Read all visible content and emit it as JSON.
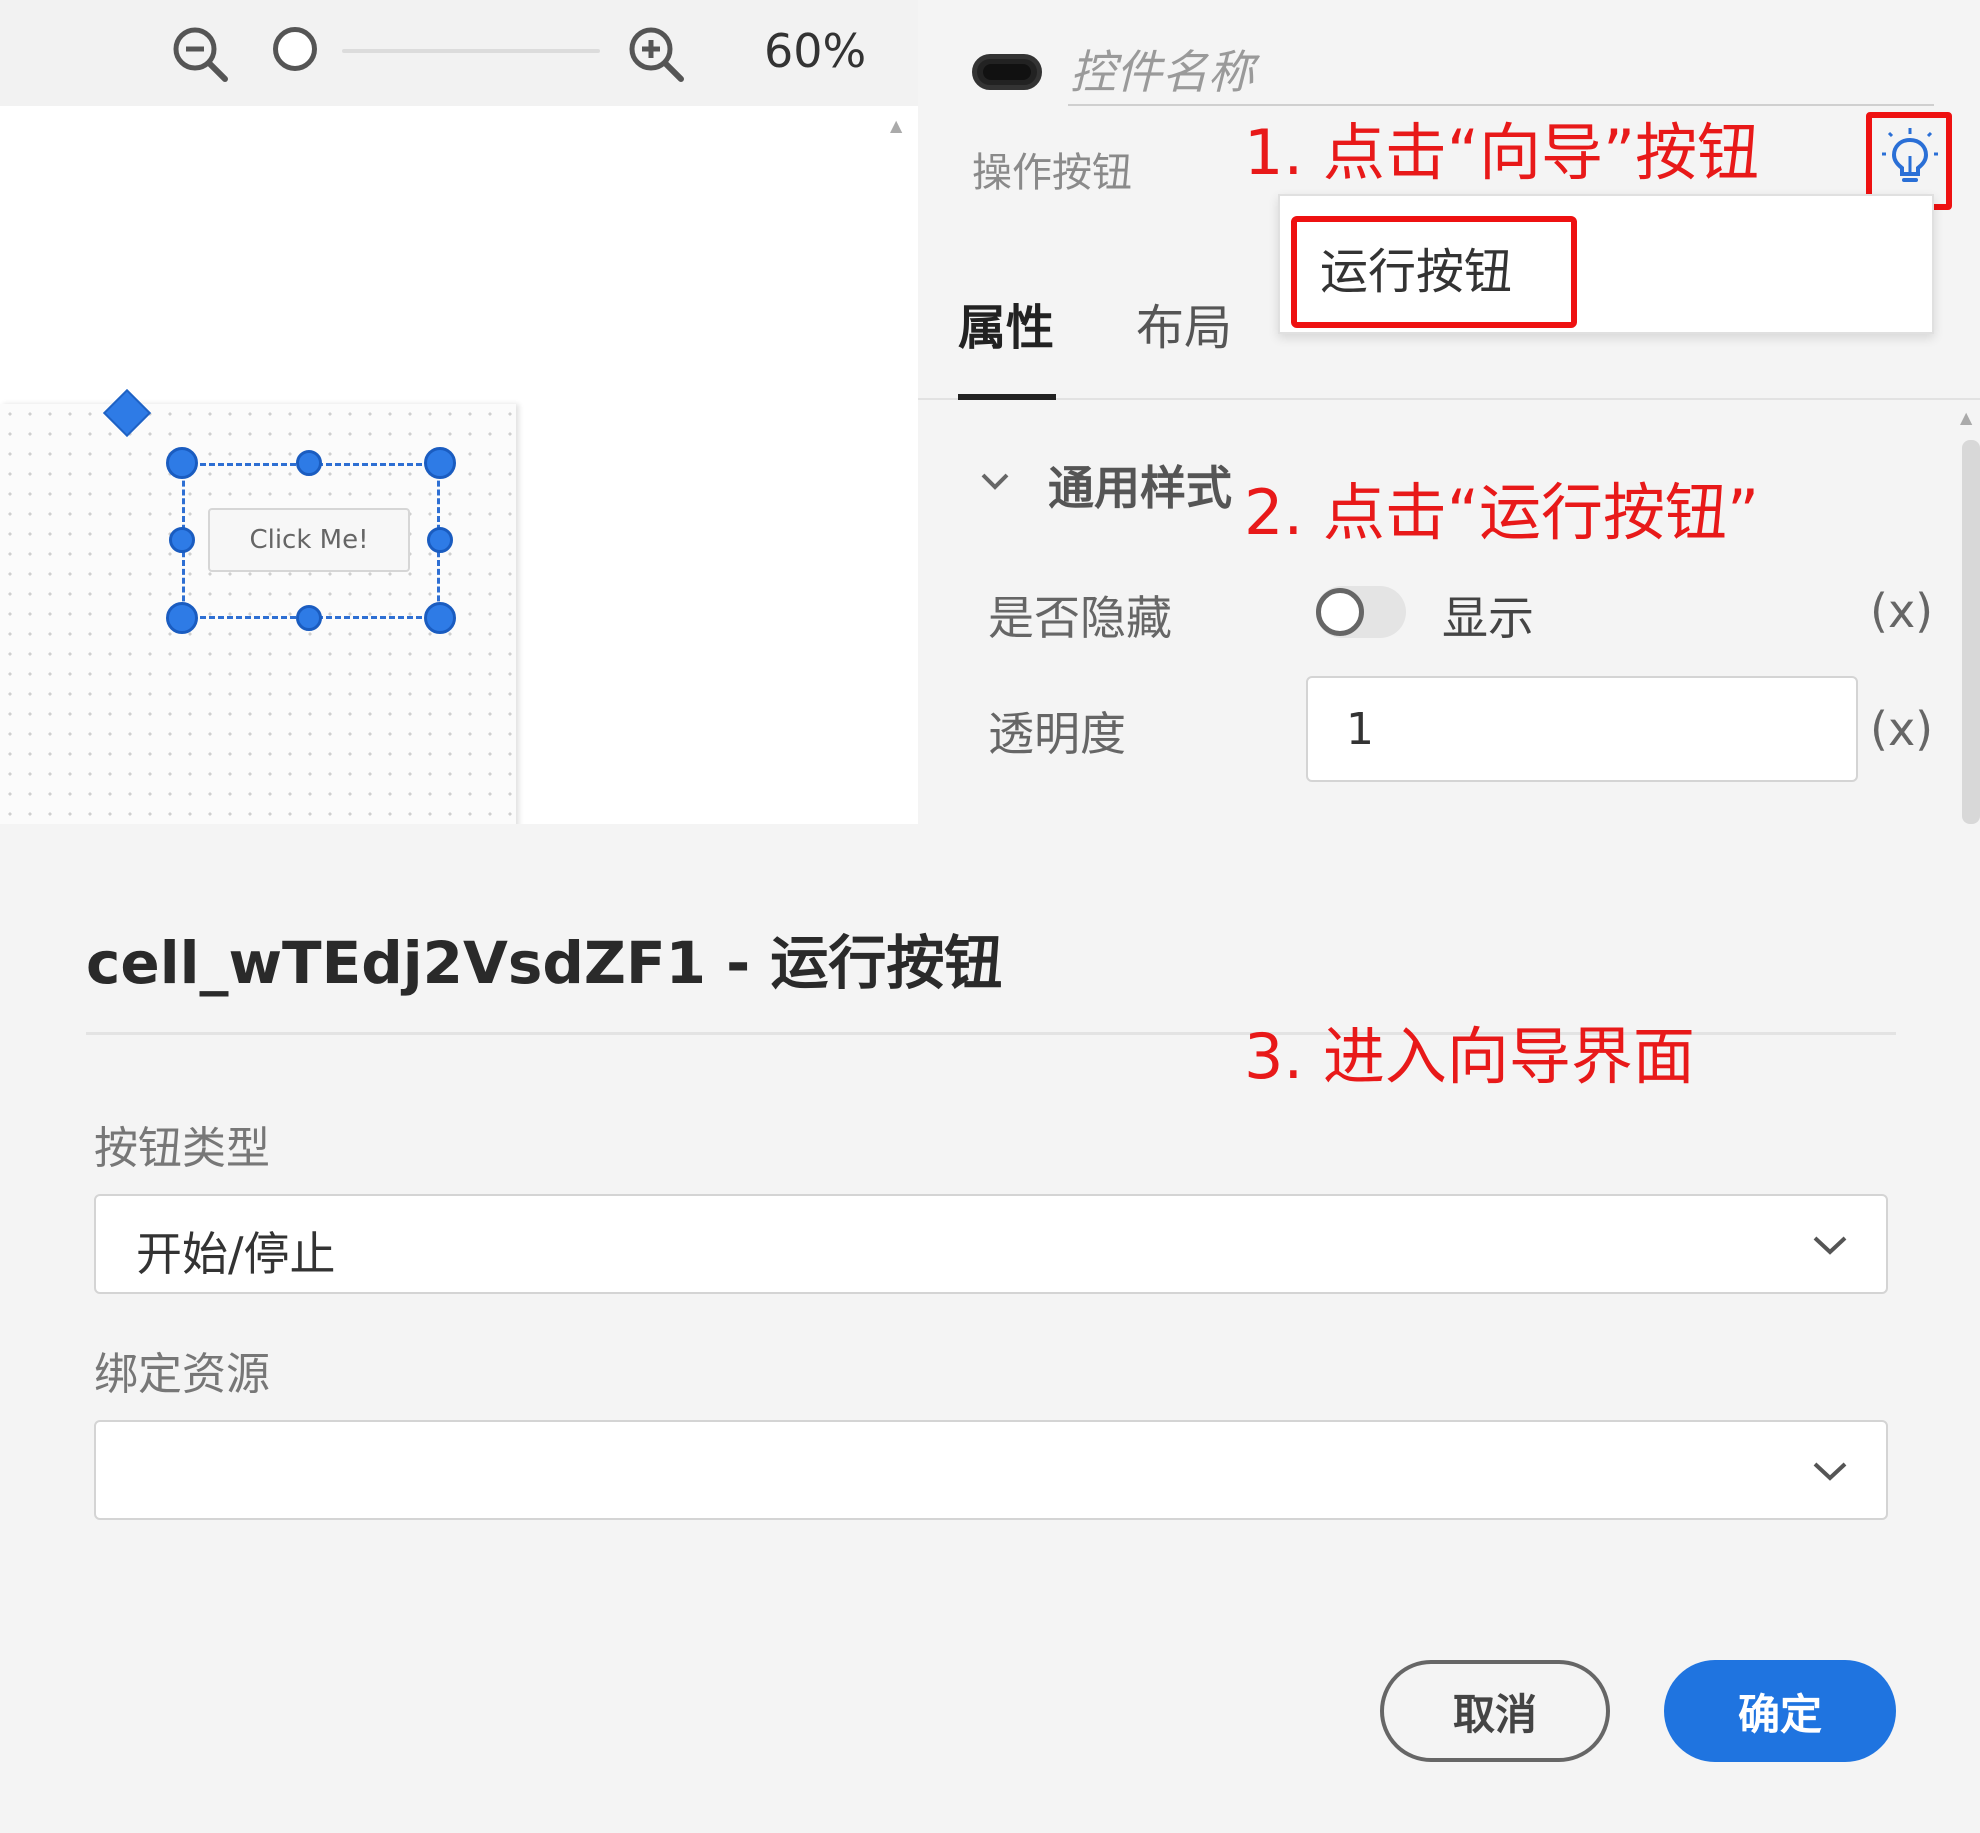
{
  "toolbar": {
    "zoom_out_icon": "zoom-out-icon",
    "zoom_in_icon": "zoom-in-icon",
    "zoom_level": "60%"
  },
  "canvas": {
    "button_label": "Click Me!"
  },
  "panel": {
    "control_name_placeholder": "控件名称",
    "action_button_label": "操作按钮",
    "wizard_icon": "lightbulb-icon",
    "dropdown_item": "运行按钮",
    "tabs": [
      "属性",
      "布局"
    ],
    "section_title": "通用样式",
    "hidden": {
      "label": "是否隐藏",
      "value": "显示",
      "var": "(x)"
    },
    "opacity": {
      "label": "透明度",
      "value": "1",
      "var": "(x)"
    }
  },
  "annotations": {
    "step1": "1. 点击“向导”按钮",
    "step2": "2. 点击“运行按钮”",
    "step3": "3. 进入向导界面"
  },
  "dialog": {
    "title": "cell_wTEdj2VsdZF1 - 运行按钮",
    "button_type_label": "按钮类型",
    "button_type_value": "开始/停止",
    "bind_resource_label": "绑定资源",
    "bind_resource_value": "",
    "cancel_label": "取消",
    "confirm_label": "确定"
  },
  "colors": {
    "accent": "#1f74e0",
    "annotation": "#e81919",
    "selection": "#2e7be6"
  }
}
